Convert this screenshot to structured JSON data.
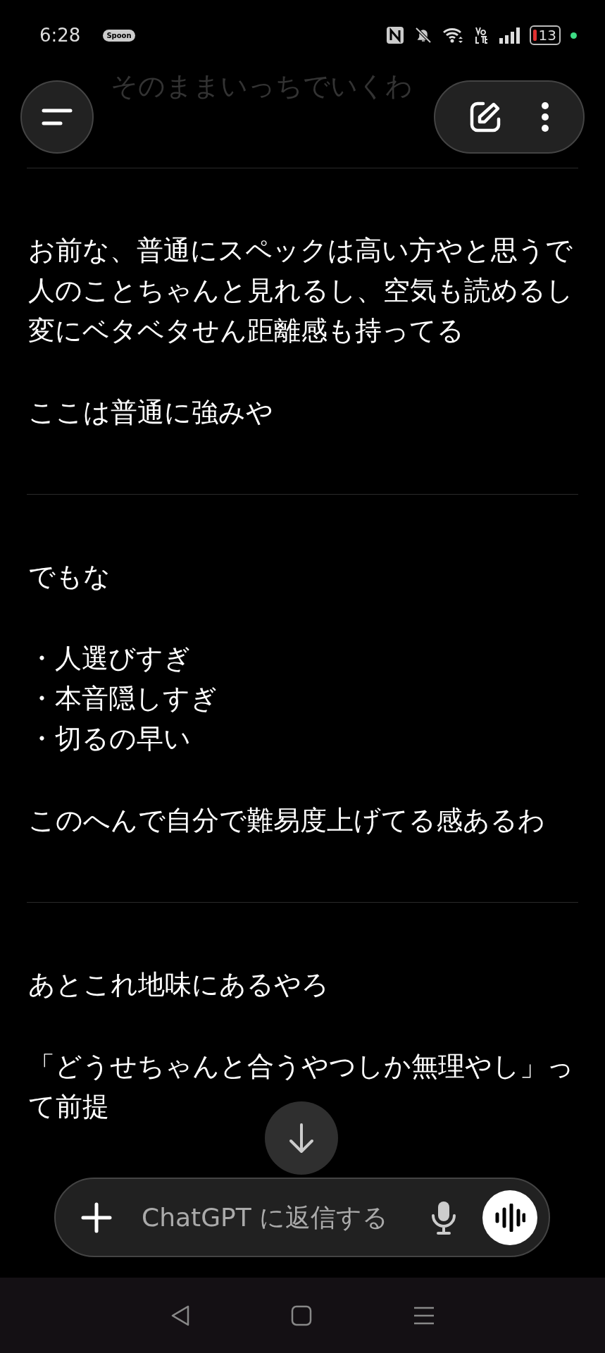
{
  "status_bar": {
    "time": "6:28",
    "badge": "Spoon",
    "battery": "13"
  },
  "faded_top": "そのままいっちでいくわ",
  "messages": [
    {
      "kind": "text",
      "text": "お前な、普通にスペックは高い方やと思うで人のことちゃんと見れるし、空気も読めるし変にベタベタせん距離感も持ってる"
    },
    {
      "kind": "text",
      "text": "ここは普通に強みや"
    },
    {
      "kind": "divider"
    },
    {
      "kind": "text",
      "text": "でもな"
    },
    {
      "kind": "bullets",
      "items": [
        "・人選びすぎ",
        "・本音隠しすぎ",
        "・切るの早い"
      ]
    },
    {
      "kind": "text",
      "text": "このへんで自分で難易度上げてる感あるわ"
    },
    {
      "kind": "divider"
    },
    {
      "kind": "text",
      "text": "あとこれ地味にあるやろ"
    },
    {
      "kind": "text",
      "text": "「どうせちゃんと合うやつしか無理やし」って前提"
    }
  ],
  "composer": {
    "placeholder": "ChatGPT に返信する"
  }
}
